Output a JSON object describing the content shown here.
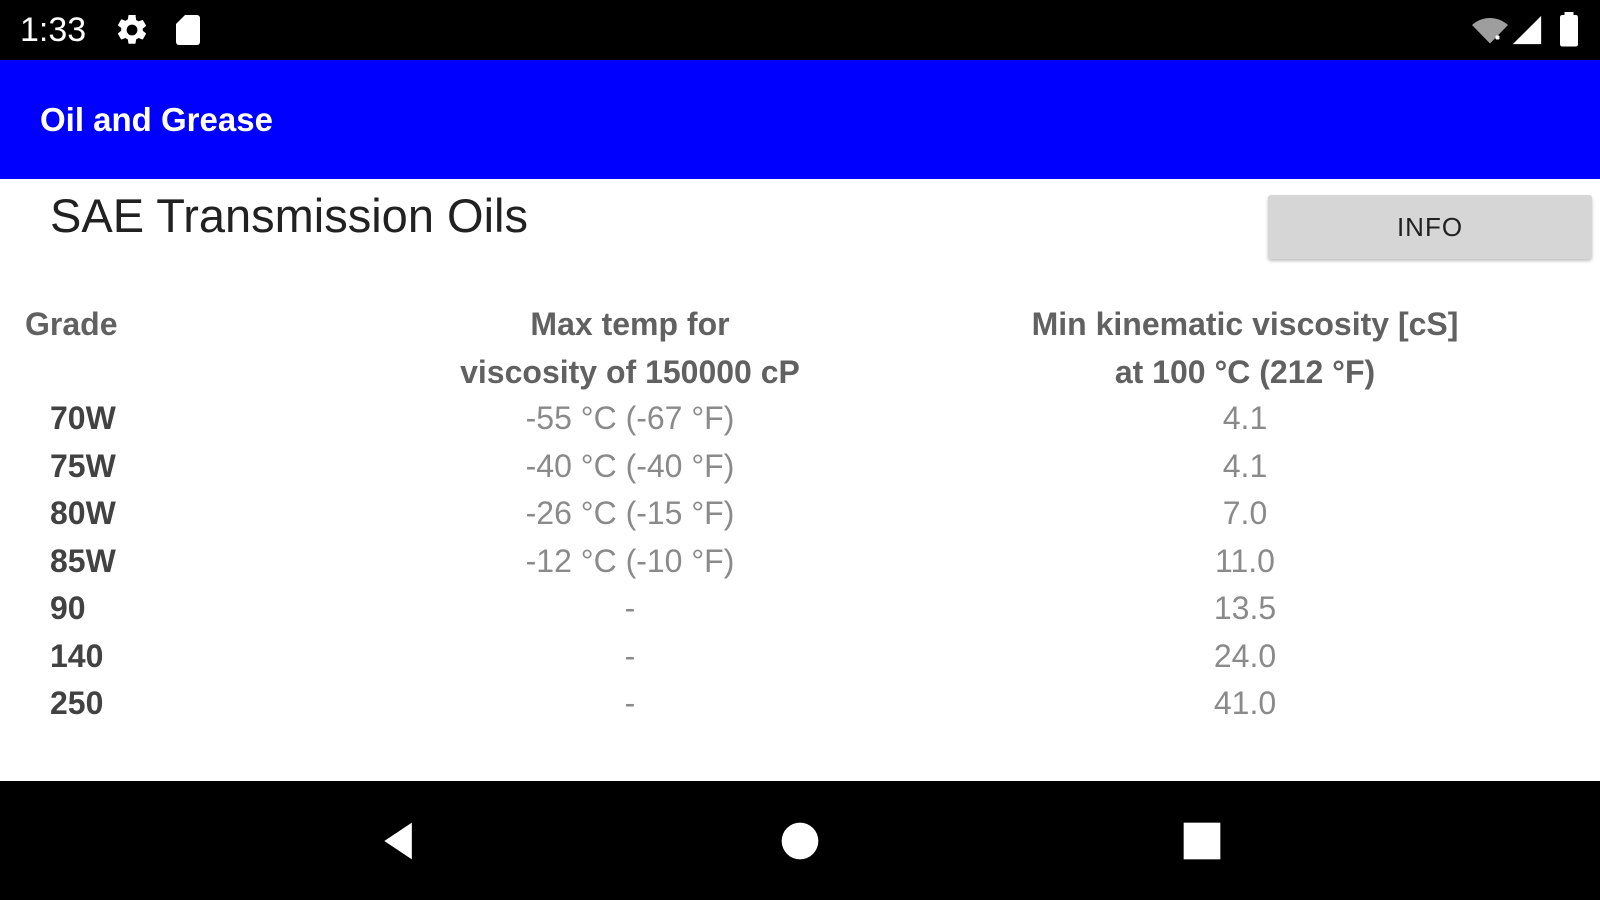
{
  "status_bar": {
    "time": "1:33",
    "left_icons": [
      "gear-icon",
      "sd-card-icon"
    ],
    "right_icons": [
      "wifi-off-icon",
      "cell-signal-icon",
      "battery-icon"
    ]
  },
  "app_bar": {
    "title": "Oil and Grease",
    "color": "#0000ff"
  },
  "page": {
    "title": "SAE Transmission Oils",
    "info_button": "INFO"
  },
  "table": {
    "headers": {
      "grade": "Grade",
      "temp_line1": "Max temp for",
      "temp_line2": "viscosity of 150000 cP",
      "visc_line1": "Min kinematic viscosity [cS]",
      "visc_line2": "at 100 °C (212 °F)"
    },
    "rows": [
      {
        "grade": "70W",
        "temp": "-55 °C (-67 °F)",
        "visc": "4.1"
      },
      {
        "grade": "75W",
        "temp": "-40 °C (-40 °F)",
        "visc": "4.1"
      },
      {
        "grade": "80W",
        "temp": "-26 °C (-15 °F)",
        "visc": "7.0"
      },
      {
        "grade": "85W",
        "temp": "-12 °C (-10 °F)",
        "visc": "11.0"
      },
      {
        "grade": "90",
        "temp": "-",
        "visc": "13.5"
      },
      {
        "grade": "140",
        "temp": "-",
        "visc": "24.0"
      },
      {
        "grade": "250",
        "temp": "-",
        "visc": "41.0"
      }
    ]
  },
  "nav_bar": {
    "buttons": [
      "back-icon",
      "home-icon",
      "recents-icon"
    ]
  }
}
